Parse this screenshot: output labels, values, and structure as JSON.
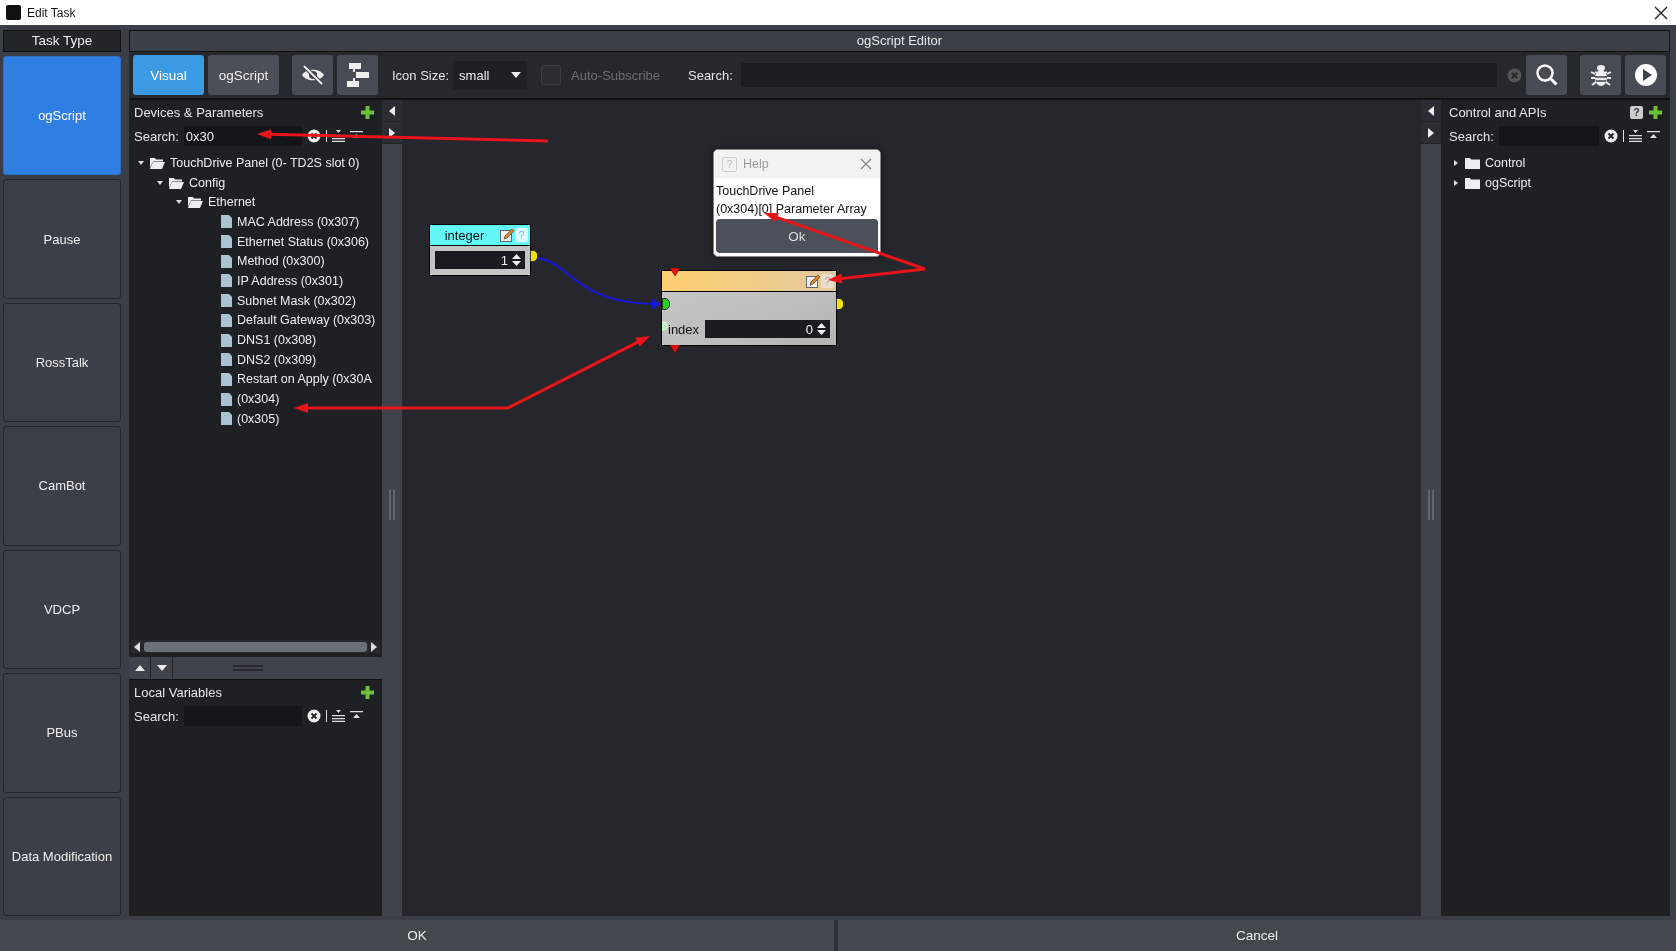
{
  "window": {
    "title": "Edit Task"
  },
  "task_type": {
    "title": "Task Type",
    "items": [
      {
        "label": "ogScript",
        "selected": true
      },
      {
        "label": "Pause",
        "selected": false
      },
      {
        "label": "RossTalk",
        "selected": false
      },
      {
        "label": "CamBot",
        "selected": false
      },
      {
        "label": "VDCP",
        "selected": false
      },
      {
        "label": "PBus",
        "selected": false
      },
      {
        "label": "Data Modification",
        "selected": false
      }
    ]
  },
  "editor": {
    "title": "ogScript Editor",
    "toolbar": {
      "tabs": [
        {
          "label": "Visual",
          "selected": true
        },
        {
          "label": "ogScript",
          "selected": false
        }
      ],
      "icon_size_label": "Icon Size:",
      "icon_size": "small",
      "auto_subscribe": {
        "label": "Auto-Subscribe",
        "checked": false,
        "disabled": true
      },
      "search_label": "Search:"
    },
    "devices": {
      "title": "Devices & Parameters",
      "search_label": "Search:",
      "search_value": "0x30",
      "tree": [
        {
          "kind": "folder",
          "label": "TouchDrive Panel (0- TD2S slot 0)",
          "expanded": true,
          "children": [
            {
              "kind": "folder",
              "label": "Config",
              "expanded": true,
              "children": [
                {
                  "kind": "folder",
                  "label": "Ethernet",
                  "expanded": true,
                  "children": [
                    {
                      "kind": "param",
                      "label": "MAC Address (0x307)"
                    },
                    {
                      "kind": "param",
                      "label": "Ethernet Status (0x306)"
                    },
                    {
                      "kind": "param",
                      "label": "Method (0x300)"
                    },
                    {
                      "kind": "param",
                      "label": "IP Address (0x301)"
                    },
                    {
                      "kind": "param",
                      "label": "Subnet Mask (0x302)"
                    },
                    {
                      "kind": "param",
                      "label": "Default Gateway (0x303)"
                    },
                    {
                      "kind": "param",
                      "label": "DNS1 (0x308)"
                    },
                    {
                      "kind": "param",
                      "label": "DNS2 (0x309)"
                    },
                    {
                      "kind": "param",
                      "label": "Restart on Apply (0x30A"
                    },
                    {
                      "kind": "param",
                      "label": "(0x304)"
                    },
                    {
                      "kind": "param",
                      "label": "(0x305)"
                    }
                  ]
                }
              ]
            }
          ]
        }
      ]
    },
    "local_variables": {
      "title": "Local Variables",
      "search_label": "Search:"
    },
    "canvas": {
      "nodes": [
        {
          "kind": "integer",
          "title": "integer",
          "help_icon": "?",
          "value": "1"
        },
        {
          "kind": "parameter",
          "help_icon": "?",
          "field_label": "index",
          "value": "0"
        }
      ],
      "help": {
        "icon": "?",
        "title": "Help",
        "text": "TouchDrive Panel\n(0x304)[0] Parameter Array",
        "button": "Ok"
      }
    },
    "apis": {
      "title": "Control and APIs",
      "help_icon": "?",
      "search_label": "Search:",
      "tree": [
        {
          "kind": "folder",
          "label": "Control",
          "expanded": false
        },
        {
          "kind": "folder",
          "label": "ogScript",
          "expanded": false
        }
      ]
    }
  },
  "buttons": [
    {
      "label": "OK"
    },
    {
      "label": "Cancel"
    }
  ]
}
